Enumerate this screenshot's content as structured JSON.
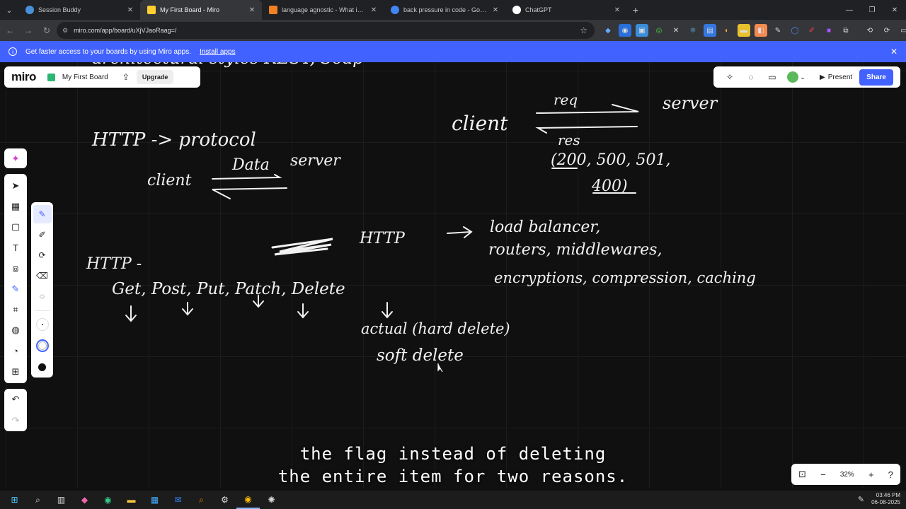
{
  "browser": {
    "tabs": [
      {
        "title": "Session Buddy",
        "color": "#4a90d9",
        "active": false
      },
      {
        "title": "My First Board - Miro",
        "color": "#ffd02f",
        "active": true
      },
      {
        "title": "language agnostic - What is an",
        "color": "#f48024",
        "active": false
      },
      {
        "title": "back pressure in code - Google",
        "color": "#4285f4",
        "active": false
      },
      {
        "title": "ChatGPT",
        "color": "#ffffff",
        "active": false
      }
    ],
    "url": "miro.com/app/board/uXjVJaoRaag=/",
    "new_tab": "+",
    "close": "✕"
  },
  "banner": {
    "text": "Get faster access to your boards by using Miro apps.",
    "link": "Install apps"
  },
  "miro": {
    "logo": "miro",
    "board_name": "My First Board",
    "upgrade": "Upgrade",
    "present": "Present",
    "share": "Share",
    "zoom": "32%"
  },
  "whiteboard": {
    "top_partial": "architectural styles  REST, Soap",
    "left": {
      "line1": "HTTP  ->  protocol",
      "client": "client",
      "data": "Data",
      "server": "server"
    },
    "right": {
      "client": "client",
      "req": "req",
      "server": "server",
      "res": "res",
      "codes1": "(200, 500, 501,",
      "codes2": "400)"
    },
    "middle": {
      "http": "HTTP",
      "arrow": "->",
      "line1": "load balancer,",
      "line2": "routers, middlewares,",
      "line3": "encryptions, compression, caching"
    },
    "methods": {
      "label": "HTTP -",
      "list": "Get, Post, Put, Patch, Delete",
      "hard": "actual (hard delete)",
      "soft": "soft delete"
    }
  },
  "subtitle": {
    "line1": "the flag instead of deleting",
    "line2": "the entire item for two reasons."
  },
  "taskbar": {
    "time": "03:46 PM",
    "date": "06-08-2025"
  }
}
